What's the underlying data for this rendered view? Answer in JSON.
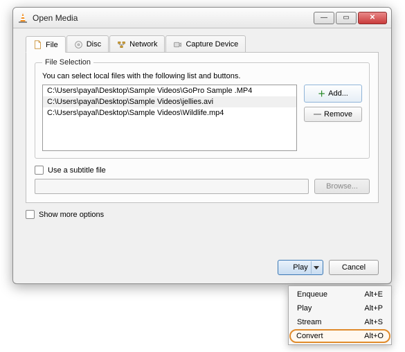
{
  "window": {
    "title": "Open Media"
  },
  "tabs": {
    "file": "File",
    "disc": "Disc",
    "network": "Network",
    "capture": "Capture Device"
  },
  "file_section": {
    "legend": "File Selection",
    "hint": "You can select local files with the following list and buttons.",
    "files": [
      "C:\\Users\\payal\\Desktop\\Sample Videos\\GoPro Sample .MP4",
      "C:\\Users\\payal\\Desktop\\Sample Videos\\jellies.avi",
      "C:\\Users\\payal\\Desktop\\Sample Videos\\Wildlife.mp4"
    ],
    "add_label": "Add...",
    "remove_label": "Remove"
  },
  "subtitle": {
    "checkbox_label": "Use a subtitle file",
    "browse_label": "Browse..."
  },
  "show_more_label": "Show more options",
  "footer": {
    "play_label": "Play",
    "cancel_label": "Cancel"
  },
  "menu": {
    "items": [
      {
        "label": "Enqueue",
        "shortcut": "Alt+E"
      },
      {
        "label": "Play",
        "shortcut": "Alt+P"
      },
      {
        "label": "Stream",
        "shortcut": "Alt+S"
      },
      {
        "label": "Convert",
        "shortcut": "Alt+O"
      }
    ]
  }
}
